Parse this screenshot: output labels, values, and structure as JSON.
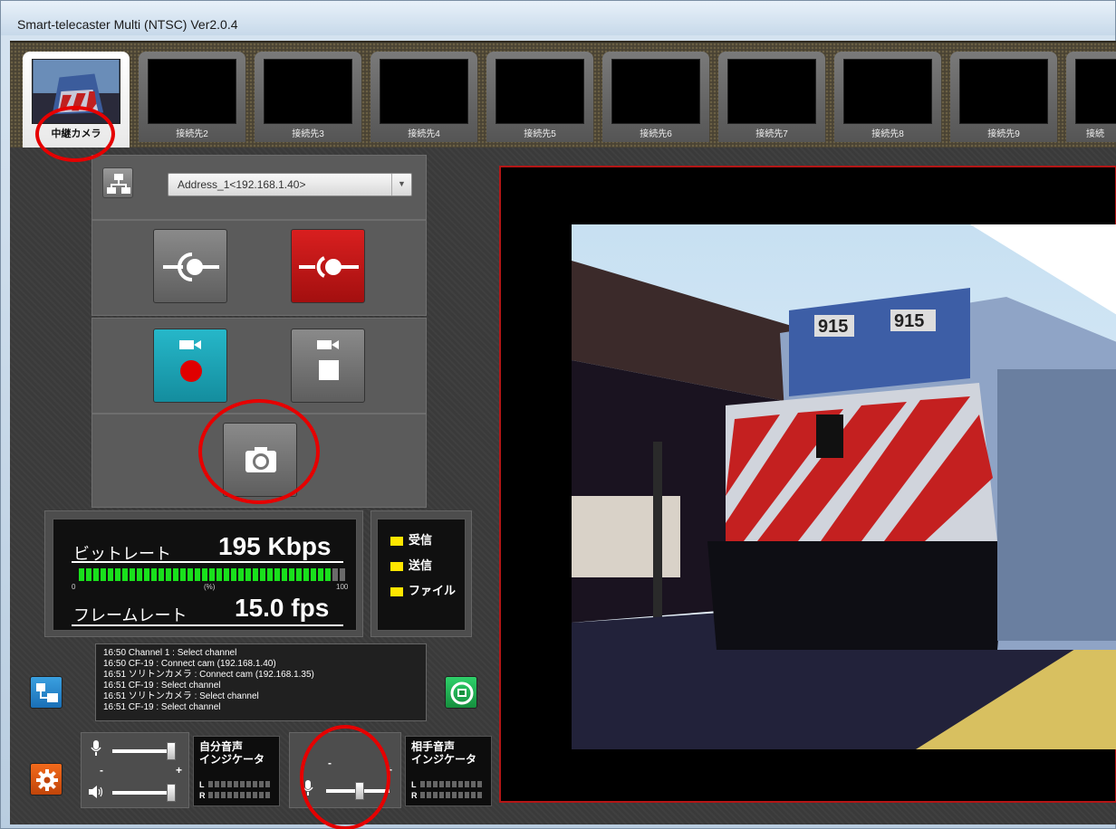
{
  "window": {
    "title": "Smart-telecaster Multi (NTSC) Ver2.0.4"
  },
  "tabs": [
    {
      "label": "中継カメラ",
      "active": true
    },
    {
      "label": "接続先2"
    },
    {
      "label": "接続先3"
    },
    {
      "label": "接続先4"
    },
    {
      "label": "接続先5"
    },
    {
      "label": "接続先6"
    },
    {
      "label": "接続先7"
    },
    {
      "label": "接続先8"
    },
    {
      "label": "接続先9"
    },
    {
      "label": "接続"
    }
  ],
  "connection": {
    "address_value": "Address_1<192.168.1.40>",
    "network_icon": "network-icon"
  },
  "buttons": {
    "connect_icon": "connect-icon",
    "disconnect_icon": "disconnect-icon",
    "record_icon": "record-video-icon",
    "stop_icon": "stop-video-icon",
    "snapshot_icon": "camera-icon"
  },
  "stats": {
    "bitrate_label": "ビットレート",
    "bitrate_value": "195 Kbps",
    "frame_label": "フレームレート",
    "frame_value": "15.0 fps",
    "scale_min": "0",
    "scale_mid": "(%)",
    "scale_max": "100",
    "meter_level_percent": 95
  },
  "legend": {
    "receive": "受信",
    "send": "送信",
    "file": "ファイル",
    "color": "#ffe600"
  },
  "log": [
    "16:50 Channel 1 : Select channel",
    "16:50 CF-19 : Connect cam (192.168.1.40)",
    "16:51 ソリトンカメラ : Connect cam (192.168.1.35)",
    "16:51 CF-19 : Select channel",
    "16:51 ソリトンカメラ : Select channel",
    "16:51 CF-19 : Select channel"
  ],
  "audio": {
    "minus": "-",
    "plus": "+",
    "self_title_1": "自分音声",
    "self_title_2": "インジケータ",
    "remote_title_1": "相手音声",
    "remote_title_2": "インジケータ",
    "left": "L",
    "right": "R"
  },
  "video": {
    "plate_left": "915",
    "plate_right": "915"
  },
  "colors": {
    "accent_red": "#e60000",
    "meter_green": "#19e01c"
  }
}
